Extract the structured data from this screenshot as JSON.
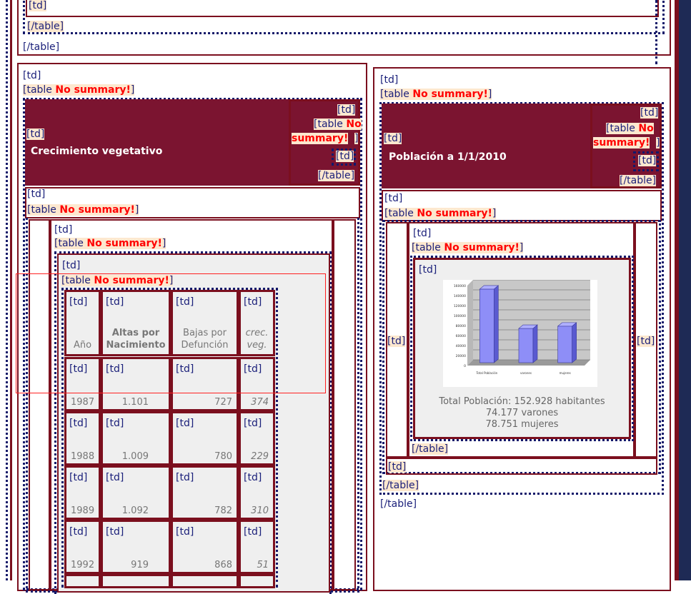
{
  "markers": {
    "td": "[td]",
    "table_prefix": "[table ",
    "table_suffix": "]",
    "no_summary": "No summary!",
    "end_table": "[/table]",
    "no_summary_split1": "No",
    "no_summary_split2": "summary!"
  },
  "left_panel": {
    "header_title": "Crecimiento vegetativo"
  },
  "right_panel": {
    "header_title": "Población a 1/1/2010",
    "caption_line1": "Total Población: 152.928 habitantes",
    "caption_line2": "74.177 varones",
    "caption_line3": "78.751 mujeres"
  },
  "growth_table": {
    "headers": [
      "Año",
      "Altas por\nNacimiento",
      "Bajas por\nDefunción",
      "crec.\nveg."
    ],
    "rows": [
      [
        "1987",
        "1.101",
        "727",
        "374"
      ],
      [
        "1988",
        "1.009",
        "780",
        "229"
      ],
      [
        "1989",
        "1.092",
        "782",
        "310"
      ],
      [
        "1992",
        "919",
        "868",
        "51"
      ]
    ]
  },
  "chart_data": {
    "type": "bar",
    "categories": [
      "Total Población",
      "varones",
      "mujeres"
    ],
    "values": [
      152928,
      74177,
      78751
    ],
    "y_tick_labels": [
      "0",
      "20000",
      "40000",
      "60000",
      "80000",
      "100000",
      "120000",
      "140000",
      "160000"
    ],
    "ylim": [
      0,
      160000
    ],
    "grid": true,
    "bar_color": "#8e8ef7"
  },
  "colors": {
    "maroon": "#7b0f1e",
    "header_bg": "#7b1430",
    "navy_dotted": "#14196a",
    "label_bg": "#fde8cf",
    "warning_red": "#ff0000"
  }
}
